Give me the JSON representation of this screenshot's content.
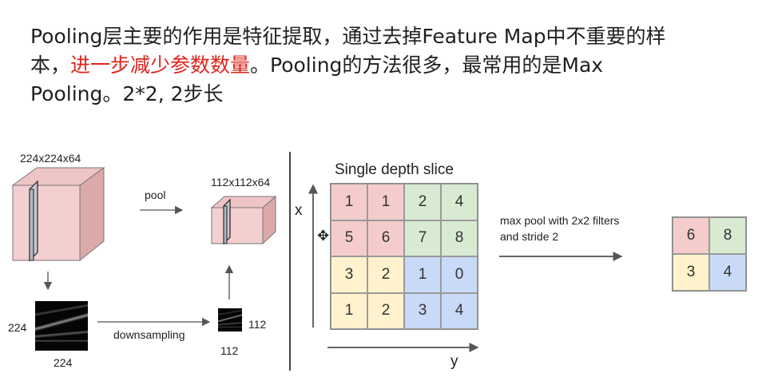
{
  "text": {
    "line1": "Pooling层主要的作用是特征提取，通过去掉Feature Map中不重要的样",
    "line2_pre": "本，",
    "line2_hl": "进一步减少参数数量",
    "line2_post": "。Pooling的方法很多，最常用的是Max",
    "line3": "Pooling。2*2, 2步长"
  },
  "left_diagram": {
    "cube_large_label": "224x224x64",
    "cube_small_label": "112x112x64",
    "pool_label": "pool",
    "downsampling_label": "downsampling",
    "fmap_large_left": "224",
    "fmap_large_bottom": "224",
    "fmap_small_right": "112",
    "fmap_small_bottom": "112"
  },
  "right_diagram": {
    "title": "Single depth slice",
    "x_axis_label": "x",
    "y_axis_label": "y",
    "op_line1": "max pool with 2x2 filters",
    "op_line2": "and stride 2",
    "input_grid": [
      [
        "1",
        "1",
        "2",
        "4"
      ],
      [
        "5",
        "6",
        "7",
        "8"
      ],
      [
        "3",
        "2",
        "1",
        "0"
      ],
      [
        "1",
        "2",
        "3",
        "4"
      ]
    ],
    "output_grid": [
      [
        "6",
        "8"
      ],
      [
        "3",
        "4"
      ]
    ],
    "colors": {
      "red": "#f4cccc",
      "green": "#d9ead3",
      "yellow": "#fff2cc",
      "blue": "#c9daf8"
    }
  }
}
